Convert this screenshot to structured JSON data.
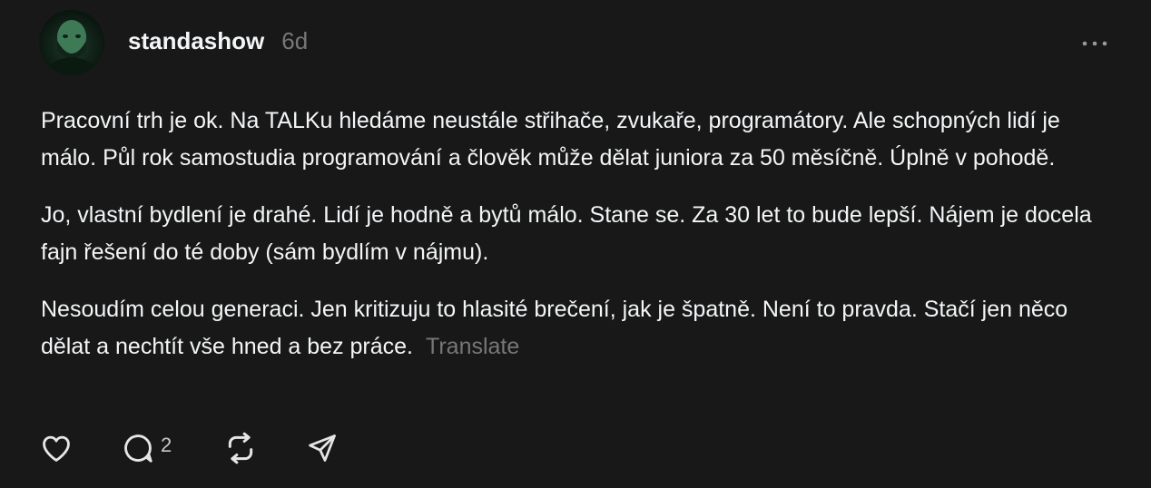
{
  "post": {
    "username": "standashow",
    "time": "6d",
    "paragraphs": [
      "Pracovní trh je ok. Na TALKu hledáme neustále střihače, zvukaře, programátory. Ale schopných lidí je málo. Půl rok samostudia programování a člověk může dělat juniora za 50 měsíčně. Úplně v pohodě.",
      "Jo, vlastní bydlení je drahé. Lidí je hodně a bytů málo. Stane se. Za 30 let to bude lepší. Nájem je docela fajn řešení do té doby (sám bydlím v nájmu).",
      "Nesoudím celou generaci. Jen kritizuju to hlasité brečení, jak je špatně. Není to pravda. Stačí jen něco dělat a nechtít vše hned a bez práce."
    ],
    "translate_label": "Translate"
  },
  "actions": {
    "like_icon": "heart-icon",
    "reply_icon": "comment-icon",
    "reply_count": "2",
    "repost_icon": "repost-icon",
    "share_icon": "send-icon"
  },
  "colors": {
    "background": "#181818",
    "text": "#f3f5f7",
    "muted": "#777777"
  }
}
